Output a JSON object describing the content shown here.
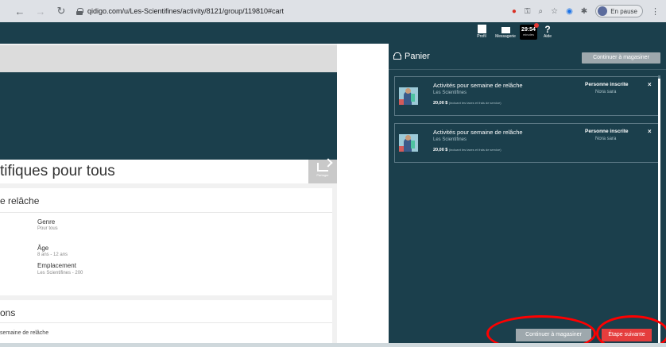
{
  "browser": {
    "url": "qidigo.com/u/Les-Scientifines/activity/8121/group/119810#cart",
    "profile_label": "En pause",
    "profile_initial": "S"
  },
  "site_header": {
    "profil": "Profil",
    "messages": "Messagerie",
    "timer_value": "29:54",
    "timer_label": "minutes",
    "aide": "Aide",
    "aide_symbol": "?"
  },
  "page": {
    "title": "tifiques pour tous",
    "share_label": "Partager",
    "section_title": "e relâche",
    "info": [
      {
        "label": "Genre",
        "value": "Pour tous"
      },
      {
        "label": "Âge",
        "value": "8 ans - 12 ans"
      },
      {
        "label": "Emplacement",
        "value": "Les Scientifines - 200"
      }
    ],
    "section2_title": "ons",
    "section2_item": "semaine de relâche"
  },
  "cart": {
    "title": "Panier",
    "continue_label": "Continuer à magasiner",
    "next_label": "Étape suivante",
    "items": [
      {
        "title": "Activités pour semaine de relâche",
        "org": "Les Scientifines",
        "price": "20,00 $",
        "price_note": "(incluant les taxes et frais de service)",
        "person_label": "Personne inscrite",
        "person_name": "Nora sara",
        "close": "×"
      },
      {
        "title": "Activités pour semaine de relâche",
        "org": "Les Scientifines",
        "price": "20,00 $",
        "price_note": "(incluant les taxes et frais de service)",
        "person_label": "Personne inscrite",
        "person_name": "Nora sara",
        "close": "×"
      }
    ]
  },
  "colors": {
    "teal": "#1b3f4c",
    "next_button": "#e53d3d",
    "highlight_ring": "#ff0000"
  }
}
